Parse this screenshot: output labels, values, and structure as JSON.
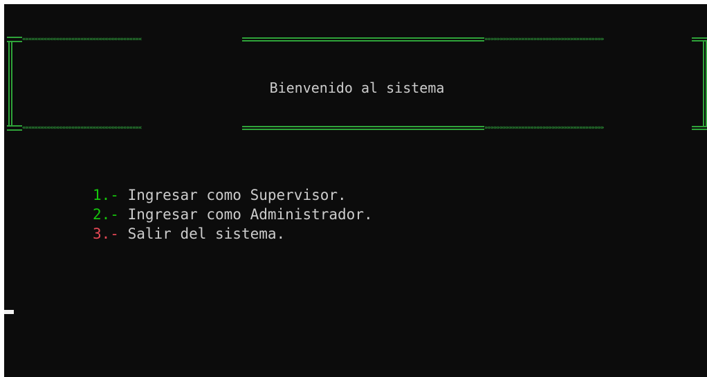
{
  "banner": {
    "title": "Bienvenido al sistema",
    "left_chevrons": "«««««««««««««««««««««««««««««««««««««««",
    "right_chevrons": "»»»»»»»»»»»»»»»»»»»»»»»»»»»»»»»»»»»»»»»"
  },
  "menu": {
    "items": [
      {
        "number": "1",
        "separator": ".- ",
        "label": "Ingresar como Supervisor."
      },
      {
        "number": "2",
        "separator": ".- ",
        "label": "Ingresar como Administrador."
      },
      {
        "number": "3",
        "separator": ".- ",
        "label": "Salir del sistema."
      }
    ]
  },
  "colors": {
    "background": "#0c0c0c",
    "border": "#2fa43a",
    "text": "#cccccc",
    "option_green": "#16c60c",
    "option_red": "#e74856"
  }
}
